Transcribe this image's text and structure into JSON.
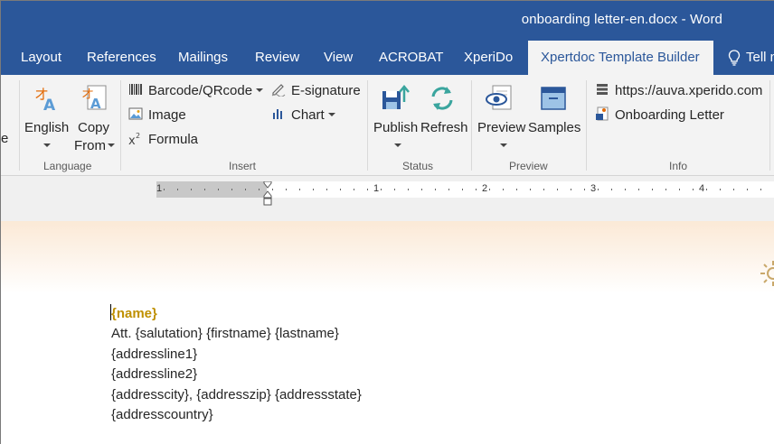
{
  "window": {
    "title": "onboarding letter-en.docx  -  Word"
  },
  "tabs": [
    {
      "label": "Layout"
    },
    {
      "label": "References"
    },
    {
      "label": "Mailings"
    },
    {
      "label": "Review"
    },
    {
      "label": "View"
    },
    {
      "label": "ACROBAT"
    },
    {
      "label": "XperiDo"
    },
    {
      "label": "Xpertdoc Template Builder",
      "active": true
    },
    {
      "label": "Tell m"
    }
  ],
  "ribbon": {
    "language": {
      "english": "English",
      "copy": "Copy",
      "from": "From",
      "group": "Language"
    },
    "insert": {
      "barcode": "Barcode/QRcode",
      "image": "Image",
      "formula": "Formula",
      "esignature": "E-signature",
      "chart": "Chart",
      "group": "Insert"
    },
    "status": {
      "publish": "Publish",
      "refresh": "Refresh",
      "group": "Status"
    },
    "preview": {
      "preview": "Preview",
      "samples": "Samples",
      "group": "Preview"
    },
    "info": {
      "url": "https://auva.xperido.com",
      "template": "Onboarding Letter",
      "group": "Info"
    },
    "cut_label": "e"
  },
  "ruler": {
    "numbers": [
      "1",
      "1",
      "2",
      "3",
      "4"
    ]
  },
  "document": {
    "lines": [
      "{name}",
      "Att. {salutation} {firstname} {lastname}",
      "{addressline1}",
      "{addressline2}",
      "{addresscity}, {addresszip} {addressstate}",
      "{addresscountry}"
    ]
  },
  "colors": {
    "titlebar": "#2b579a",
    "placeholder_bold": "#bf9000"
  }
}
